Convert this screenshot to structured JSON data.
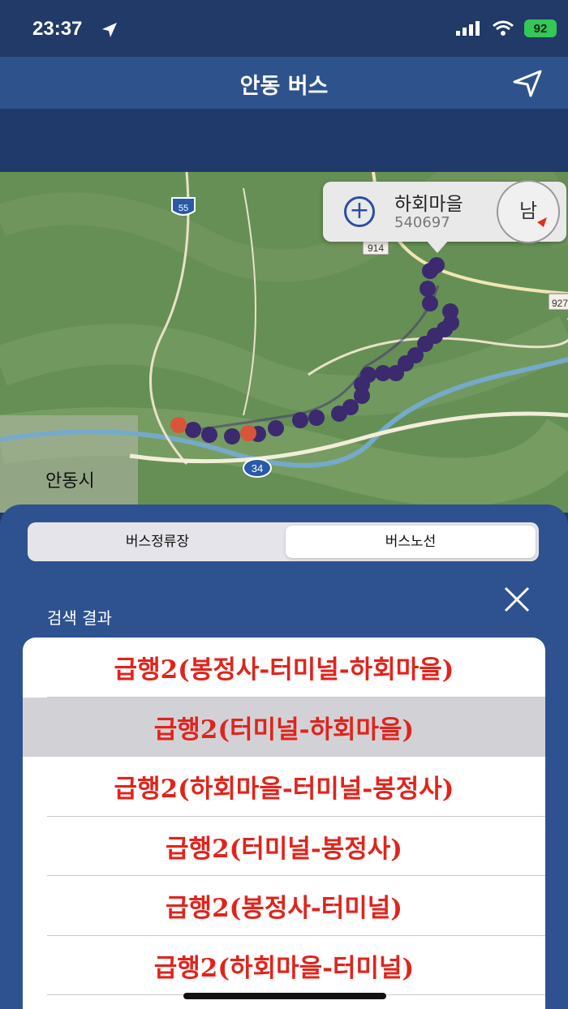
{
  "status_bar": {
    "time": "23:37",
    "battery": "92"
  },
  "nav": {
    "title": "안동 버스"
  },
  "map": {
    "labels": {
      "city": "안동시",
      "shield_55": "55",
      "route_914": "914",
      "route_927": "927",
      "shield_34": "34"
    },
    "callout": {
      "name": "하회마을",
      "code": "540697",
      "plus": "+"
    },
    "compass": "남"
  },
  "sheet": {
    "tabs": [
      "버스정류장",
      "버스노선"
    ],
    "selected_tab": "버스노선",
    "results_label": "검색 결과",
    "results": [
      "급행2(봉정사-터미널-하회마을)",
      "급행2(터미널-하회마을)",
      "급행2(하회마을-터미널-봉정사)",
      "급행2(터미널-봉정사)",
      "급행2(봉정사-터미널)",
      "급행2(하회마을-터미널)"
    ],
    "selected_result": "급행2(터미널-하회마을)"
  },
  "colors": {
    "accent": "#2e528f",
    "result_text": "#e0241c",
    "stop_pin": "#3b2a6e",
    "terminal_pin": "#d9553a"
  }
}
